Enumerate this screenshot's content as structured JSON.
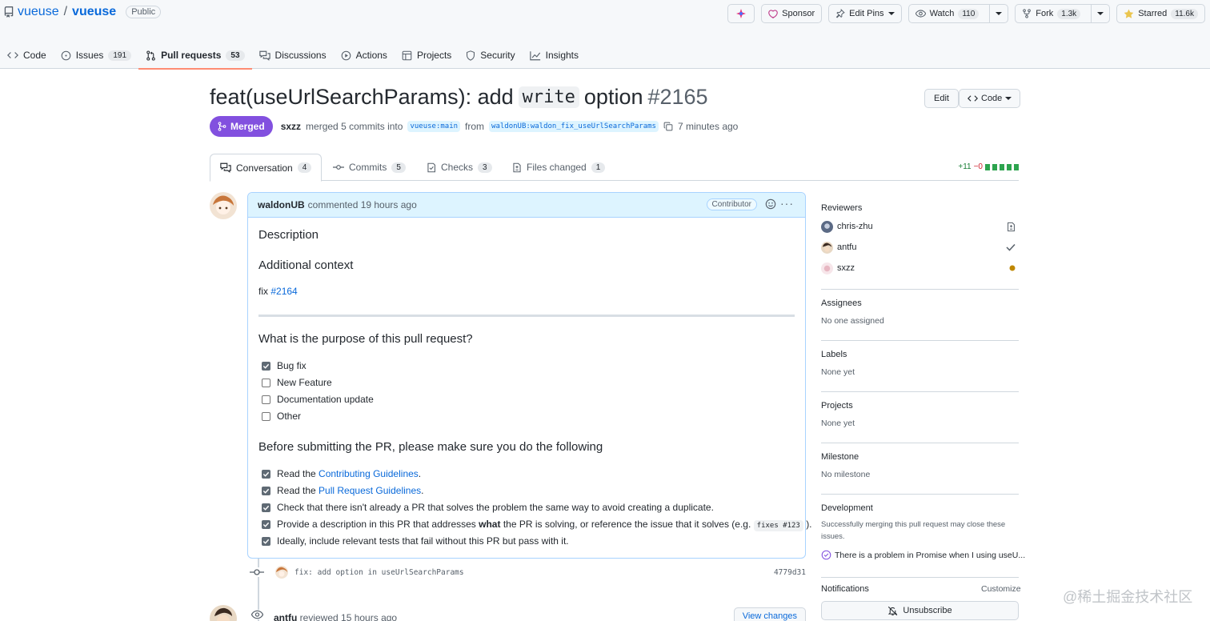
{
  "repo": {
    "owner": "vueuse",
    "separator": "/",
    "name": "vueuse",
    "visibility": "Public",
    "actions": {
      "sponsor": "Sponsor",
      "edit_pins": "Edit Pins",
      "watch": "Watch",
      "watch_count": "110",
      "fork": "Fork",
      "fork_count": "1.3k",
      "starred": "Starred",
      "star_count": "11.6k"
    },
    "nav": [
      {
        "label": "Code",
        "count": ""
      },
      {
        "label": "Issues",
        "count": "191"
      },
      {
        "label": "Pull requests",
        "count": "53"
      },
      {
        "label": "Discussions",
        "count": ""
      },
      {
        "label": "Actions",
        "count": ""
      },
      {
        "label": "Projects",
        "count": ""
      },
      {
        "label": "Security",
        "count": ""
      },
      {
        "label": "Insights",
        "count": ""
      }
    ]
  },
  "pr": {
    "title_prefix": "feat(useUrlSearchParams): add",
    "title_code": "write",
    "title_suffix": "option",
    "number": "#2165",
    "edit": "Edit",
    "code": "Code",
    "status": "Merged",
    "author": "sxzz",
    "merged_text": "merged 5 commits into",
    "base_branch": "vueuse:main",
    "from_text": "from",
    "head_branch": "waldonUB:waldon_fix_useUrlSearchParams",
    "time": "7 minutes ago",
    "tabs": [
      {
        "label": "Conversation",
        "count": "4"
      },
      {
        "label": "Commits",
        "count": "5"
      },
      {
        "label": "Checks",
        "count": "3"
      },
      {
        "label": "Files changed",
        "count": "1"
      }
    ],
    "additions": "+11",
    "deletions": "−0"
  },
  "comment": {
    "user": "waldonUB",
    "meta": "commented 19 hours ago",
    "role": "Contributor",
    "more": "···",
    "h_description": "Description",
    "h_context": "Additional context",
    "fix_text": "fix",
    "fix_link": "#2164",
    "h_purpose": "What is the purpose of this pull request?",
    "purpose": [
      {
        "label": "Bug fix",
        "checked": true
      },
      {
        "label": "New Feature",
        "checked": false
      },
      {
        "label": "Documentation update",
        "checked": false
      },
      {
        "label": "Other",
        "checked": false
      }
    ],
    "h_before": "Before submitting the PR, please make sure you do the following",
    "before": {
      "item1_pre": "Read the",
      "item1_link": "Contributing Guidelines",
      "item1_post": ".",
      "item2_pre": "Read the",
      "item2_link": "Pull Request Guidelines",
      "item2_post": ".",
      "item3": "Check that there isn't already a PR that solves the problem the same way to avoid creating a duplicate.",
      "item4_pre": "Provide a description in this PR that addresses",
      "item4_bold": "what",
      "item4_mid": "the PR is solving, or reference the issue that it solves (e.g.",
      "item4_code": "fixes #123",
      "item4_post": ").",
      "item5": "Ideally, include relevant tests that fail without this PR but pass with it."
    }
  },
  "timeline": {
    "commit_msg": "fix: add option in useUrlSearchParams",
    "commit_sha": "4779d31",
    "review_user": "antfu",
    "review_text": "reviewed 15 hours ago",
    "view_changes": "View changes"
  },
  "sidebar": {
    "reviewers_title": "Reviewers",
    "reviewers": [
      "chris-zhu",
      "antfu",
      "sxzz"
    ],
    "assignees_title": "Assignees",
    "assignees_value": "No one assigned",
    "labels_title": "Labels",
    "labels_value": "None yet",
    "projects_title": "Projects",
    "projects_value": "None yet",
    "milestone_title": "Milestone",
    "milestone_value": "No milestone",
    "development_title": "Development",
    "development_text1": "Successfully merging this pull request may close these",
    "development_text2": "issues.",
    "linked_issue": "There is a problem in Promise when I using useU...",
    "notifications_title": "Notifications",
    "customize": "Customize",
    "unsubscribe": "Unsubscribe"
  },
  "watermark": "@稀土掘金技术社区",
  "colors": {
    "merged": "#8250df",
    "link": "#0969da",
    "tab_underline": "#fd8c73",
    "additions": "#1a7f37",
    "deletions": "#cf222e",
    "pending": "#bf8700"
  }
}
